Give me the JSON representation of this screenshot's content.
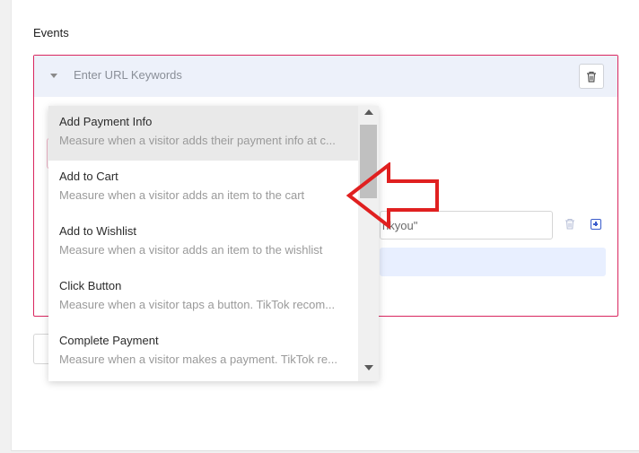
{
  "section": {
    "title": "Events"
  },
  "event_card": {
    "url_input_placeholder": "Enter URL Keywords",
    "keyword_value": "nkyou\""
  },
  "dropdown": {
    "options": [
      {
        "title": "Add Payment Info",
        "description": "Measure when a visitor adds their payment info at c...",
        "selected": true
      },
      {
        "title": "Add to Cart",
        "description": "Measure when a visitor adds an item to the cart",
        "selected": false
      },
      {
        "title": "Add to Wishlist",
        "description": "Measure when a visitor adds an item to the wishlist",
        "selected": false
      },
      {
        "title": "Click Button",
        "description": "Measure when a visitor taps a button. TikTok recom...",
        "selected": false
      },
      {
        "title": "Complete Payment",
        "description": "Measure when a visitor makes a payment. TikTok re...",
        "selected": false
      }
    ]
  },
  "colors": {
    "card_border": "#d9265f",
    "header_bg": "#edf1fa",
    "annotation_arrow": "#e02020",
    "add_icon": "#3a5ccc"
  },
  "icons": {
    "collapse": "caret-down-icon",
    "delete": "trash-icon",
    "add": "plus-square-icon",
    "annotation": "left-arrow-annotation-icon"
  }
}
